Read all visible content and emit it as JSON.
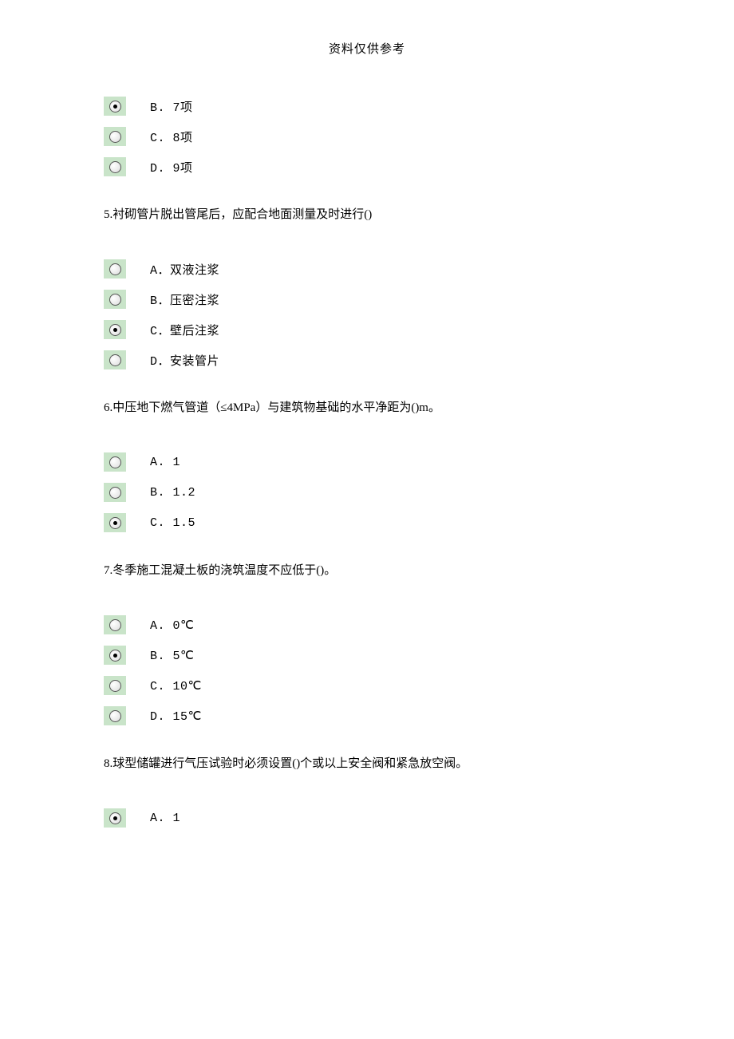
{
  "header": "资料仅供参考",
  "questions": {
    "q4": {
      "options": [
        {
          "label": "B. 7项",
          "selected": true
        },
        {
          "label": "C. 8项",
          "selected": false
        },
        {
          "label": "D. 9项",
          "selected": false
        }
      ]
    },
    "q5": {
      "text": "5.衬砌管片脱出管尾后，应配合地面测量及时进行()",
      "options": [
        {
          "label": "A．双液注浆",
          "selected": false
        },
        {
          "label": "B．压密注浆",
          "selected": false
        },
        {
          "label": "C．壁后注浆",
          "selected": true
        },
        {
          "label": "D．安装管片",
          "selected": false
        }
      ]
    },
    "q6": {
      "text": "6.中压地下燃气管道（≤4MPa）与建筑物基础的水平净距为()m。",
      "options": [
        {
          "label": "A. 1",
          "selected": false
        },
        {
          "label": "B. 1.2",
          "selected": false
        },
        {
          "label": "C. 1.5",
          "selected": true
        }
      ]
    },
    "q7": {
      "text": "7.冬季施工混凝土板的浇筑温度不应低于()。",
      "options": [
        {
          "label": "A. 0℃",
          "selected": false
        },
        {
          "label": "B. 5℃",
          "selected": true
        },
        {
          "label": "C. 10℃",
          "selected": false
        },
        {
          "label": "D. 15℃",
          "selected": false
        }
      ]
    },
    "q8": {
      "text": "8.球型储罐进行气压试验时必须设置()个或以上安全阀和紧急放空阀。",
      "options": [
        {
          "label": "A. 1",
          "selected": true
        }
      ]
    }
  }
}
